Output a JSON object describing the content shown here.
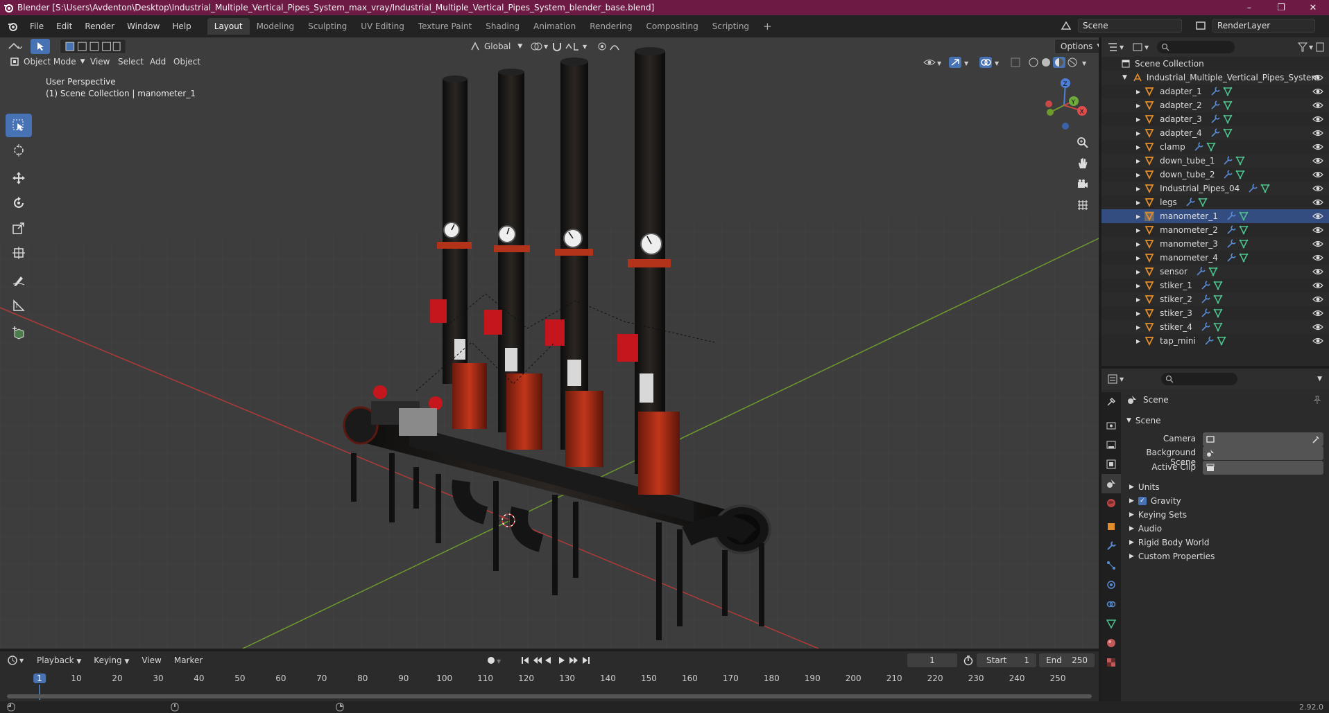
{
  "window": {
    "title": "Blender [S:\\Users\\Avdenton\\Desktop\\Industrial_Multiple_Vertical_Pipes_System_max_vray/Industrial_Multiple_Vertical_Pipes_System_blender_base.blend]",
    "minimize": "–",
    "maximize": "❐",
    "close": "✕"
  },
  "menubar": {
    "items": [
      "File",
      "Edit",
      "Render",
      "Window",
      "Help"
    ]
  },
  "workspaces": {
    "tabs": [
      "Layout",
      "Modeling",
      "Sculpting",
      "UV Editing",
      "Texture Paint",
      "Shading",
      "Animation",
      "Rendering",
      "Compositing",
      "Scripting"
    ],
    "active": "Layout",
    "add_icon": "plus-icon"
  },
  "scene_selector": {
    "value": "Scene"
  },
  "renderlayer_selector": {
    "value": "RenderLayer"
  },
  "viewport": {
    "mode": "Object Mode",
    "menus": [
      "View",
      "Select",
      "Add",
      "Object"
    ],
    "transform_orientation": "Global",
    "options_label": "Options",
    "perspective_label": "User Perspective",
    "collection_label": "(1) Scene Collection | manometer_1",
    "gizmo": {
      "x": "X",
      "y": "Y",
      "z": "Z"
    },
    "colors": {
      "background": "#3d3d3d",
      "x_axis": "#b03a3a",
      "y_axis": "#6e9a2d",
      "grid": "#474747"
    }
  },
  "toolbar": {
    "tools": [
      "select-box-icon",
      "cursor-icon",
      "move-icon",
      "rotate-icon",
      "scale-icon",
      "transform-icon",
      "annotate-icon",
      "measure-icon",
      "add-cube-icon"
    ],
    "active": "select-box-icon"
  },
  "outliner": {
    "root": "Scene Collection",
    "collection": "Industrial_Multiple_Vertical_Pipes_System",
    "objects": [
      "adapter_1",
      "adapter_2",
      "adapter_3",
      "adapter_4",
      "clamp",
      "down_tube_1",
      "down_tube_2",
      "Industrial_Pipes_04",
      "legs",
      "manometer_1",
      "manometer_2",
      "manometer_3",
      "manometer_4",
      "sensor",
      "stiker_1",
      "stiker_2",
      "stiker_3",
      "stiker_4",
      "tap_mini"
    ],
    "selected": "manometer_1"
  },
  "properties": {
    "context": "Scene",
    "panel": "Scene",
    "fields": [
      {
        "label": "Camera",
        "icon": "camera-icon"
      },
      {
        "label": "Background Scene",
        "icon": "scene-icon"
      },
      {
        "label": "Active Clip",
        "icon": "clip-icon"
      }
    ],
    "subpanels": [
      "Units",
      "Gravity",
      "Keying Sets",
      "Audio",
      "Rigid Body World",
      "Custom Properties"
    ],
    "gravity_checked": true
  },
  "timeline": {
    "menus": [
      "Playback",
      "Keying",
      "View",
      "Marker"
    ],
    "current_frame": "1",
    "start_label": "Start",
    "start": "1",
    "end_label": "End",
    "end": "250",
    "ticks": [
      "1",
      "10",
      "20",
      "30",
      "40",
      "50",
      "60",
      "70",
      "80",
      "90",
      "100",
      "110",
      "120",
      "130",
      "140",
      "150",
      "160",
      "170",
      "180",
      "190",
      "200",
      "210",
      "220",
      "230",
      "240",
      "250"
    ]
  },
  "statusbar": {
    "version": "2.92.0"
  }
}
